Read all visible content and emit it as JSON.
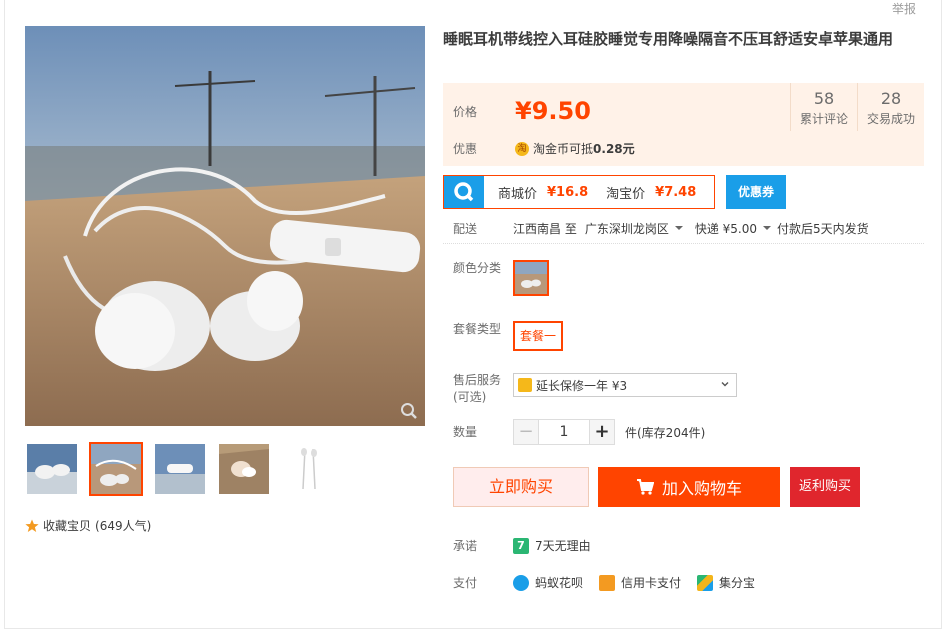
{
  "header": {
    "report": "举报"
  },
  "product": {
    "title": "睡眠耳机带线控入耳硅胶睡觉专用降噪隔音不压耳舒适安卓苹果通用"
  },
  "price": {
    "label": "价格",
    "value": "¥9.50",
    "stats": [
      {
        "num": "58",
        "caption": "累计评论"
      },
      {
        "num": "28",
        "caption": "交易成功"
      }
    ],
    "promo_label": "优惠",
    "promo_icon": "淘",
    "promo_text": "淘金币可抵",
    "promo_amount": "0.28元"
  },
  "tmall": {
    "mall_label": "商城价",
    "mall_price": "¥16.8",
    "tb_label": "淘宝价",
    "tb_price": "¥7.48",
    "coupon": "优惠券"
  },
  "shipping": {
    "label": "配送",
    "from": "江西南昌 至",
    "to": "广东深圳龙岗区",
    "express": "快递 ¥5.00",
    "eta": "付款后5天内发货"
  },
  "sku": {
    "color_label": "颜色分类",
    "package_label": "套餐类型",
    "package_value": "套餐一",
    "service_label": "售后服务",
    "service_sub": "(可选)",
    "service_value": "延长保修一年 ¥3",
    "qty_label": "数量",
    "qty_value": "1",
    "minus": "−",
    "plus": "+",
    "stock": "件(库存204件)"
  },
  "actions": {
    "buy_now": "立即购买",
    "add_cart": "加入购物车",
    "rebate": "返利购买"
  },
  "gallery": {
    "favorite": "收藏宝贝",
    "popularity": "(649人气)"
  },
  "promise": {
    "label": "承诺",
    "icon": "7",
    "text": "7天无理由"
  },
  "payment": {
    "label": "支付",
    "methods": [
      "蚂蚁花呗",
      "信用卡支付",
      "集分宝"
    ]
  },
  "colors": {
    "accent": "#ff4400",
    "tmall_blue": "#1a9ee8",
    "price_bg": "#fff2e8",
    "rebate_red": "#e0262d"
  }
}
